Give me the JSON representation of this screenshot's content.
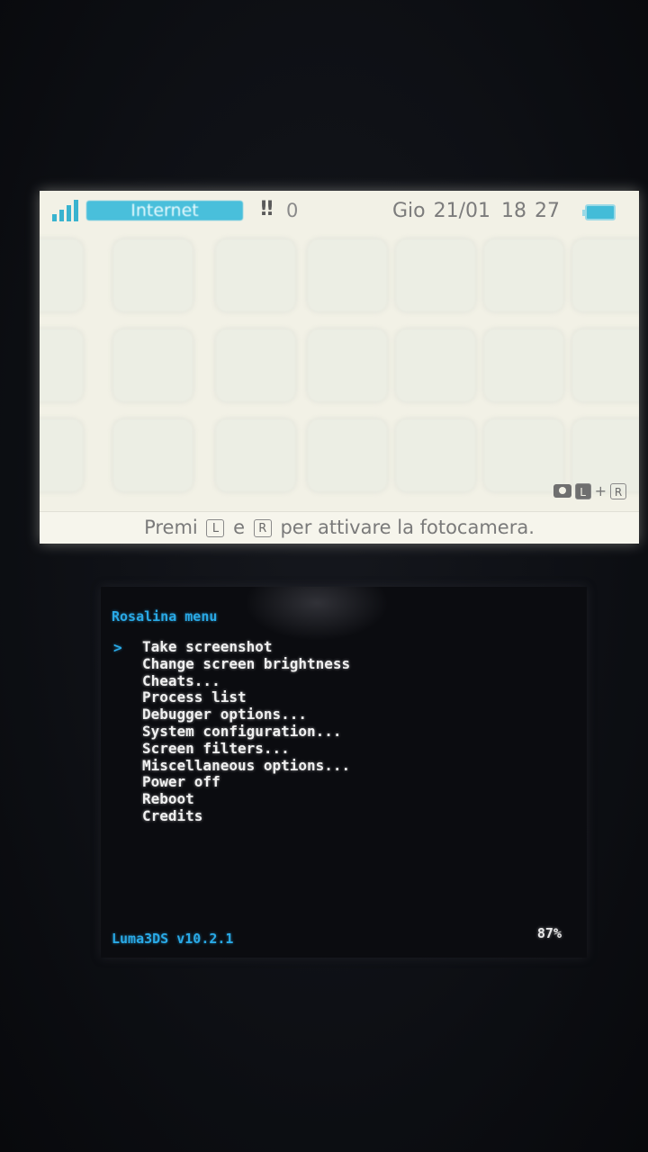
{
  "top_screen": {
    "status_bar": {
      "connection_label": "Internet",
      "notification_count": "0",
      "date": "Gio 21/01",
      "time": "18 27",
      "accent_color": "#49bfdb"
    },
    "camera_hint": {
      "key_l": "L",
      "plus": "+",
      "key_r": "R"
    },
    "bottom_hint": {
      "prefix": "Premi",
      "key_l": "L",
      "conjunction": "e",
      "key_r": "R",
      "suffix": "per attivare la fotocamera."
    },
    "icons": [
      "signal-icon",
      "notification-icon",
      "battery-icon",
      "camera-icon"
    ]
  },
  "rosalina": {
    "title": "Rosalina menu",
    "cursor_glyph": ">",
    "selected_index": 0,
    "items": [
      "Take screenshot",
      "Change screen brightness",
      "Cheats...",
      "Process list",
      "Debugger options...",
      "System configuration...",
      "Screen filters...",
      "Miscellaneous options...",
      "Power off",
      "Reboot",
      "Credits"
    ],
    "version": "Luma3DS v10.2.1",
    "battery": "87%",
    "title_color": "#29a9e6"
  }
}
